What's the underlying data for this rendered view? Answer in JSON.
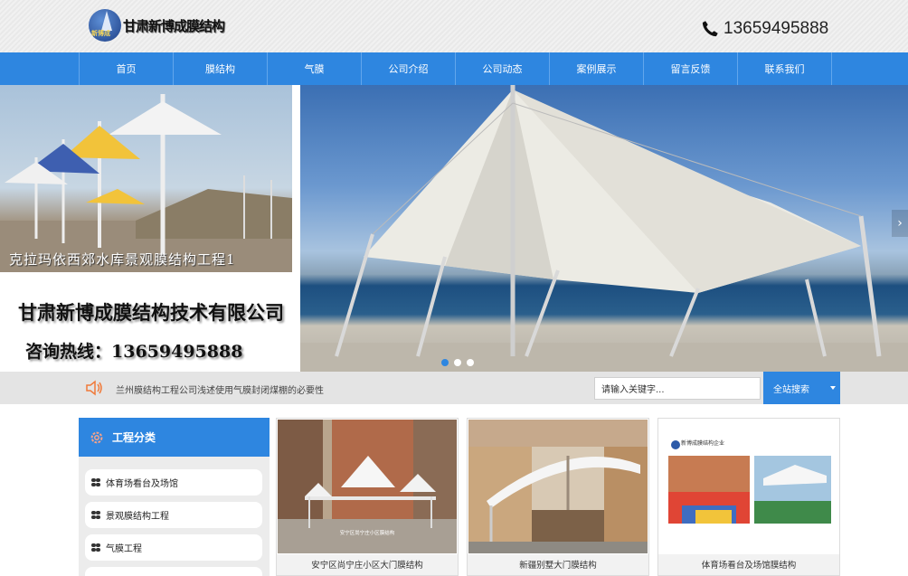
{
  "header": {
    "logo_text": "甘肃新博成膜结构",
    "logo_mark_text": "新博成",
    "phone": "13659495888"
  },
  "nav": {
    "items": [
      {
        "label": "首页"
      },
      {
        "label": "膜结构"
      },
      {
        "label": "气膜"
      },
      {
        "label": "公司介绍"
      },
      {
        "label": "公司动态"
      },
      {
        "label": "案例展示"
      },
      {
        "label": "留言反馈"
      },
      {
        "label": "联系我们"
      }
    ]
  },
  "banner": {
    "caption": "克拉玛依西郊水库景观膜结构工程1",
    "company": "甘肃新博成膜结构技术有限公司",
    "hotline": "咨询热线：13659495888",
    "slides": 3,
    "active_slide": 1
  },
  "notice": {
    "text": "兰州膜结构工程公司浅述使用气膜封闭煤棚的必要性"
  },
  "search": {
    "value": "请输入关键字...",
    "button_label": "全站搜索"
  },
  "sidebar": {
    "title": "工程分类",
    "items": [
      {
        "label": "体育场看台及场馆"
      },
      {
        "label": "景观膜结构工程"
      },
      {
        "label": "气膜工程"
      }
    ]
  },
  "products": [
    {
      "caption": "安宁区尚宁庄小区大门膜结构",
      "photo_text": "安宁区尚宁庄小区膜结构"
    },
    {
      "caption": "新疆别墅大门膜结构"
    },
    {
      "caption": "体育场看台及场馆膜结构",
      "photo_text": "新博成膜结构企业"
    }
  ],
  "colors": {
    "accent": "#2e86e0",
    "notice_icon": "#f07a3a"
  }
}
